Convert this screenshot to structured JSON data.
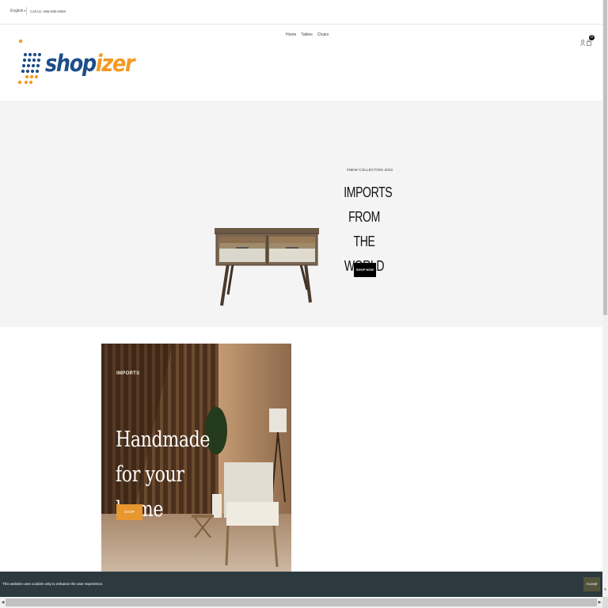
{
  "topbar": {
    "language": "English",
    "phone": "Call Us: 888-888-8888"
  },
  "header": {
    "logo": {
      "part1": "shop",
      "part2": "izer"
    },
    "nav": [
      "Home",
      "Tables",
      "Chairs"
    ],
    "cart_count": "0",
    "icons": [
      "user-icon",
      "shopping-bag-icon"
    ]
  },
  "hero": {
    "subtitle": "#NEW COLLECTION 2022",
    "title_lines": [
      "IMPORTS",
      "FROM THE",
      "WORLD"
    ],
    "button": "SHOP NOW"
  },
  "promo": {
    "tag": "IMPORTS",
    "title": "Handmade for your home",
    "button": "SHOP"
  },
  "cookie": {
    "text": "This website uses cookies only to enhance the user experience.",
    "button": "Accept"
  },
  "colors": {
    "logo_blue": "#1d4e89",
    "logo_orange": "#f39a23",
    "hero_bg": "#f4f4f4",
    "promo_button": "#e8962f",
    "cookie_bg": "#2c3a40"
  }
}
